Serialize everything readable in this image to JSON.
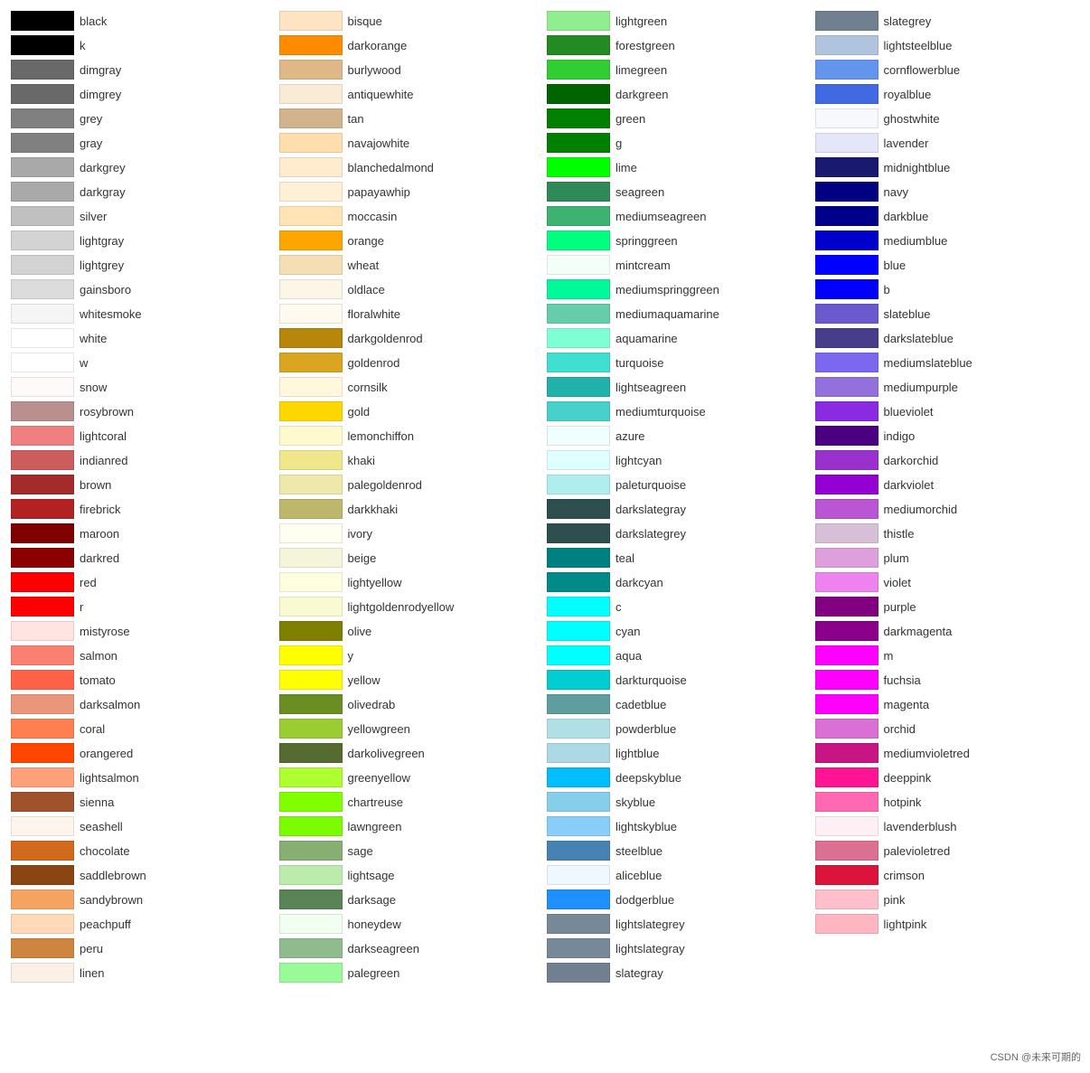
{
  "columns": [
    {
      "items": [
        {
          "name": "black",
          "color": "#000000"
        },
        {
          "name": "k",
          "color": "#000000"
        },
        {
          "name": "dimgray",
          "color": "#696969"
        },
        {
          "name": "dimgrey",
          "color": "#696969"
        },
        {
          "name": "grey",
          "color": "#808080"
        },
        {
          "name": "gray",
          "color": "#808080"
        },
        {
          "name": "darkgrey",
          "color": "#a9a9a9"
        },
        {
          "name": "darkgray",
          "color": "#a9a9a9"
        },
        {
          "name": "silver",
          "color": "#c0c0c0"
        },
        {
          "name": "lightgray",
          "color": "#d3d3d3"
        },
        {
          "name": "lightgrey",
          "color": "#d3d3d3"
        },
        {
          "name": "gainsboro",
          "color": "#dcdcdc"
        },
        {
          "name": "whitesmoke",
          "color": "#f5f5f5"
        },
        {
          "name": "white",
          "color": "#ffffff"
        },
        {
          "name": "w",
          "color": "#ffffff"
        },
        {
          "name": "snow",
          "color": "#fffafa"
        },
        {
          "name": "rosybrown",
          "color": "#bc8f8f"
        },
        {
          "name": "lightcoral",
          "color": "#f08080"
        },
        {
          "name": "indianred",
          "color": "#cd5c5c"
        },
        {
          "name": "brown",
          "color": "#a52a2a"
        },
        {
          "name": "firebrick",
          "color": "#b22222"
        },
        {
          "name": "maroon",
          "color": "#800000"
        },
        {
          "name": "darkred",
          "color": "#8b0000"
        },
        {
          "name": "red",
          "color": "#ff0000"
        },
        {
          "name": "r",
          "color": "#ff0000"
        },
        {
          "name": "mistyrose",
          "color": "#ffe4e1"
        },
        {
          "name": "salmon",
          "color": "#fa8072"
        },
        {
          "name": "tomato",
          "color": "#ff6347"
        },
        {
          "name": "darksalmon",
          "color": "#e9967a"
        },
        {
          "name": "coral",
          "color": "#ff7f50"
        },
        {
          "name": "orangered",
          "color": "#ff4500"
        },
        {
          "name": "lightsalmon",
          "color": "#ffa07a"
        },
        {
          "name": "sienna",
          "color": "#a0522d"
        },
        {
          "name": "seashell",
          "color": "#fff5ee"
        },
        {
          "name": "chocolate",
          "color": "#d2691e"
        },
        {
          "name": "saddlebrown",
          "color": "#8b4513"
        },
        {
          "name": "sandybrown",
          "color": "#f4a460"
        },
        {
          "name": "peachpuff",
          "color": "#ffdab9"
        },
        {
          "name": "peru",
          "color": "#cd853f"
        },
        {
          "name": "linen",
          "color": "#faf0e6"
        }
      ]
    },
    {
      "items": [
        {
          "name": "bisque",
          "color": "#ffe4c4"
        },
        {
          "name": "darkorange",
          "color": "#ff8c00"
        },
        {
          "name": "burlywood",
          "color": "#deb887"
        },
        {
          "name": "antiquewhite",
          "color": "#faebd7"
        },
        {
          "name": "tan",
          "color": "#d2b48c"
        },
        {
          "name": "navajowhite",
          "color": "#ffdead"
        },
        {
          "name": "blanchedalmond",
          "color": "#ffebcd"
        },
        {
          "name": "papayawhip",
          "color": "#ffefd5"
        },
        {
          "name": "moccasin",
          "color": "#ffe4b5"
        },
        {
          "name": "orange",
          "color": "#ffa500"
        },
        {
          "name": "wheat",
          "color": "#f5deb3"
        },
        {
          "name": "oldlace",
          "color": "#fdf5e6"
        },
        {
          "name": "floralwhite",
          "color": "#fffaf0"
        },
        {
          "name": "darkgoldenrod",
          "color": "#b8860b"
        },
        {
          "name": "goldenrod",
          "color": "#daa520"
        },
        {
          "name": "cornsilk",
          "color": "#fff8dc"
        },
        {
          "name": "gold",
          "color": "#ffd700"
        },
        {
          "name": "lemonchiffon",
          "color": "#fffacd"
        },
        {
          "name": "khaki",
          "color": "#f0e68c"
        },
        {
          "name": "palegoldenrod",
          "color": "#eee8aa"
        },
        {
          "name": "darkkhaki",
          "color": "#bdb76b"
        },
        {
          "name": "ivory",
          "color": "#fffff0"
        },
        {
          "name": "beige",
          "color": "#f5f5dc"
        },
        {
          "name": "lightyellow",
          "color": "#ffffe0"
        },
        {
          "name": "lightgoldenrodyellow",
          "color": "#fafad2"
        },
        {
          "name": "olive",
          "color": "#808000"
        },
        {
          "name": "y",
          "color": "#ffff00"
        },
        {
          "name": "yellow",
          "color": "#ffff00"
        },
        {
          "name": "olivedrab",
          "color": "#6b8e23"
        },
        {
          "name": "yellowgreen",
          "color": "#9acd32"
        },
        {
          "name": "darkolivegreen",
          "color": "#556b2f"
        },
        {
          "name": "greenyellow",
          "color": "#adff2f"
        },
        {
          "name": "chartreuse",
          "color": "#7fff00"
        },
        {
          "name": "lawngreen",
          "color": "#7cfc00"
        },
        {
          "name": "sage",
          "color": "#87ae73"
        },
        {
          "name": "lightsage",
          "color": "#bcecac"
        },
        {
          "name": "darksage",
          "color": "#598556"
        },
        {
          "name": "honeydew",
          "color": "#f0fff0"
        },
        {
          "name": "darkseagreen",
          "color": "#8fbc8f"
        },
        {
          "name": "palegreen",
          "color": "#98fb98"
        }
      ]
    },
    {
      "items": [
        {
          "name": "lightgreen",
          "color": "#90ee90"
        },
        {
          "name": "forestgreen",
          "color": "#228b22"
        },
        {
          "name": "limegreen",
          "color": "#32cd32"
        },
        {
          "name": "darkgreen",
          "color": "#006400"
        },
        {
          "name": "green",
          "color": "#008000"
        },
        {
          "name": "g",
          "color": "#008000"
        },
        {
          "name": "lime",
          "color": "#00ff00"
        },
        {
          "name": "seagreen",
          "color": "#2e8b57"
        },
        {
          "name": "mediumseagreen",
          "color": "#3cb371"
        },
        {
          "name": "springgreen",
          "color": "#00ff7f"
        },
        {
          "name": "mintcream",
          "color": "#f5fffa"
        },
        {
          "name": "mediumspringgreen",
          "color": "#00fa9a"
        },
        {
          "name": "mediumaquamarine",
          "color": "#66cdaa"
        },
        {
          "name": "aquamarine",
          "color": "#7fffd4"
        },
        {
          "name": "turquoise",
          "color": "#40e0d0"
        },
        {
          "name": "lightseagreen",
          "color": "#20b2aa"
        },
        {
          "name": "mediumturquoise",
          "color": "#48d1cc"
        },
        {
          "name": "azure",
          "color": "#f0ffff"
        },
        {
          "name": "lightcyan",
          "color": "#e0ffff"
        },
        {
          "name": "paleturquoise",
          "color": "#afeeee"
        },
        {
          "name": "darkslategray",
          "color": "#2f4f4f"
        },
        {
          "name": "darkslategrey",
          "color": "#2f4f4f"
        },
        {
          "name": "teal",
          "color": "#008080"
        },
        {
          "name": "darkcyan",
          "color": "#008b8b"
        },
        {
          "name": "c",
          "color": "#00ffff"
        },
        {
          "name": "cyan",
          "color": "#00ffff"
        },
        {
          "name": "aqua",
          "color": "#00ffff"
        },
        {
          "name": "darkturquoise",
          "color": "#00ced1"
        },
        {
          "name": "cadetblue",
          "color": "#5f9ea0"
        },
        {
          "name": "powderblue",
          "color": "#b0e0e6"
        },
        {
          "name": "lightblue",
          "color": "#add8e6"
        },
        {
          "name": "deepskyblue",
          "color": "#00bfff"
        },
        {
          "name": "skyblue",
          "color": "#87ceeb"
        },
        {
          "name": "lightskyblue",
          "color": "#87cefa"
        },
        {
          "name": "steelblue",
          "color": "#4682b4"
        },
        {
          "name": "aliceblue",
          "color": "#f0f8ff"
        },
        {
          "name": "dodgerblue",
          "color": "#1e90ff"
        },
        {
          "name": "lightslategrey",
          "color": "#778899"
        },
        {
          "name": "lightslategray",
          "color": "#778899"
        },
        {
          "name": "slategray",
          "color": "#708090"
        }
      ]
    },
    {
      "items": [
        {
          "name": "slategrey",
          "color": "#708090"
        },
        {
          "name": "lightsteelblue",
          "color": "#b0c4de"
        },
        {
          "name": "cornflowerblue",
          "color": "#6495ed"
        },
        {
          "name": "royalblue",
          "color": "#4169e1"
        },
        {
          "name": "ghostwhite",
          "color": "#f8f8ff"
        },
        {
          "name": "lavender",
          "color": "#e6e6fa"
        },
        {
          "name": "midnightblue",
          "color": "#191970"
        },
        {
          "name": "navy",
          "color": "#000080"
        },
        {
          "name": "darkblue",
          "color": "#00008b"
        },
        {
          "name": "mediumblue",
          "color": "#0000cd"
        },
        {
          "name": "blue",
          "color": "#0000ff"
        },
        {
          "name": "b",
          "color": "#0000ff"
        },
        {
          "name": "slateblue",
          "color": "#6a5acd"
        },
        {
          "name": "darkslateblue",
          "color": "#483d8b"
        },
        {
          "name": "mediumslateblue",
          "color": "#7b68ee"
        },
        {
          "name": "mediumpurple",
          "color": "#9370db"
        },
        {
          "name": "blueviolet",
          "color": "#8a2be2"
        },
        {
          "name": "indigo",
          "color": "#4b0082"
        },
        {
          "name": "darkorchid",
          "color": "#9932cc"
        },
        {
          "name": "darkviolet",
          "color": "#9400d3"
        },
        {
          "name": "mediumorchid",
          "color": "#ba55d3"
        },
        {
          "name": "thistle",
          "color": "#d8bfd8"
        },
        {
          "name": "plum",
          "color": "#dda0dd"
        },
        {
          "name": "violet",
          "color": "#ee82ee"
        },
        {
          "name": "purple",
          "color": "#800080"
        },
        {
          "name": "darkmagenta",
          "color": "#8b008b"
        },
        {
          "name": "m",
          "color": "#ff00ff"
        },
        {
          "name": "fuchsia",
          "color": "#ff00ff"
        },
        {
          "name": "magenta",
          "color": "#ff00ff"
        },
        {
          "name": "orchid",
          "color": "#da70d6"
        },
        {
          "name": "mediumvioletred",
          "color": "#c71585"
        },
        {
          "name": "deeppink",
          "color": "#ff1493"
        },
        {
          "name": "hotpink",
          "color": "#ff69b4"
        },
        {
          "name": "lavenderblush",
          "color": "#fff0f5"
        },
        {
          "name": "palevioletred",
          "color": "#db7093"
        },
        {
          "name": "crimson",
          "color": "#dc143c"
        },
        {
          "name": "pink",
          "color": "#ffc0cb"
        },
        {
          "name": "lightpink",
          "color": "#ffb6c1"
        }
      ]
    }
  ],
  "watermark": "CSDN @未来可期的"
}
